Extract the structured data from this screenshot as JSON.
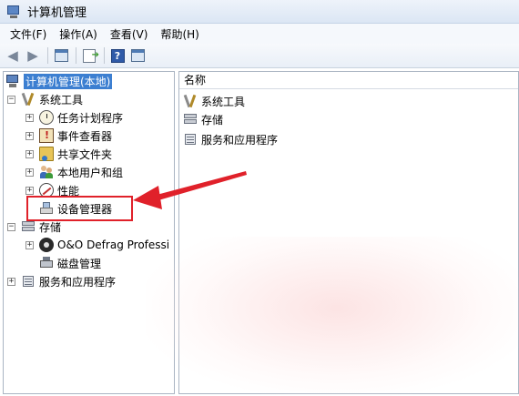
{
  "window": {
    "title": "计算机管理"
  },
  "menu": [
    "文件(F)",
    "操作(A)",
    "查看(V)",
    "帮助(H)"
  ],
  "toolbar": {
    "icons": [
      "back-icon",
      "forward-icon",
      "show-hide-tree-icon",
      "export-list-icon",
      "help-icon",
      "console-view-icon"
    ],
    "help_glyph": "?"
  },
  "tree": {
    "expand_glyph": "+",
    "collapse_glyph": "−",
    "root": "计算机管理(本地)",
    "system_tools": "系统工具",
    "task_scheduler": "任务计划程序",
    "event_viewer": "事件查看器",
    "shared_folders": "共享文件夹",
    "local_users": "本地用户和组",
    "performance": "性能",
    "device_manager": "设备管理器",
    "storage": "存储",
    "defrag": "O&O Defrag Professi",
    "disk_management": "磁盘管理",
    "services_apps": "服务和应用程序"
  },
  "list": {
    "column_name": "名称",
    "items": [
      "系统工具",
      "存储",
      "服务和应用程序"
    ]
  },
  "annotation": {
    "color": "#e0212a"
  }
}
